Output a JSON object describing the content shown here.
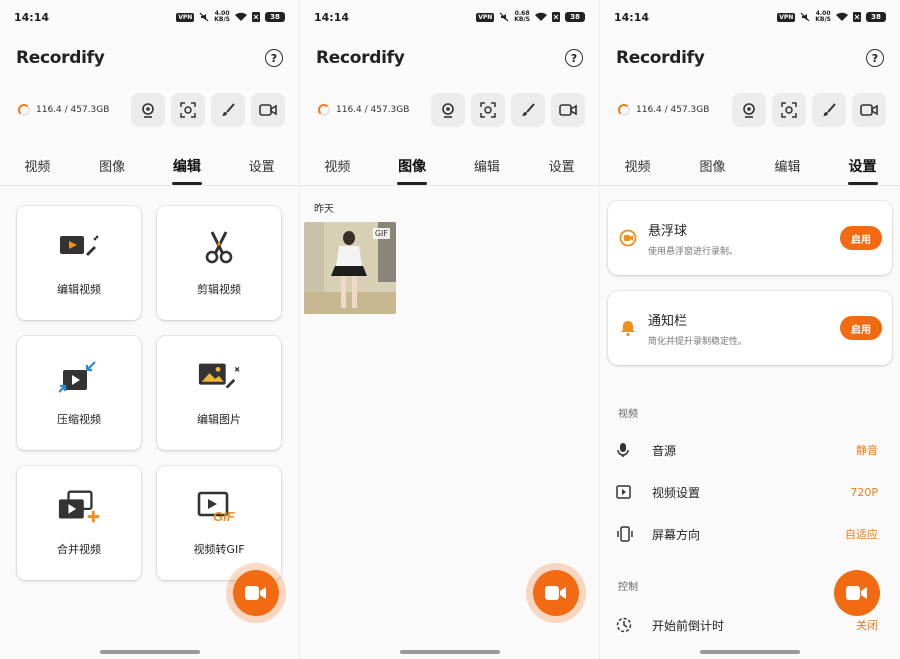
{
  "status": {
    "time": "14:14",
    "vpn": "VPN",
    "battery": "38",
    "speeds": [
      [
        "4.00",
        "KB/S"
      ],
      [
        "0.68",
        "KB/S"
      ],
      [
        "4.00",
        "KB/S"
      ]
    ]
  },
  "app": {
    "title": "Recordify",
    "help": "?"
  },
  "storage": "116.4 / 457.3GB",
  "tabs": [
    "视频",
    "图像",
    "编辑",
    "设置"
  ],
  "edit_cards": [
    {
      "label": "编辑视频",
      "icon": "edit-video-icon"
    },
    {
      "label": "剪辑视频",
      "icon": "scissors-icon"
    },
    {
      "label": "压缩视频",
      "icon": "compress-video-icon"
    },
    {
      "label": "编辑图片",
      "icon": "edit-image-icon"
    },
    {
      "label": "合并视频",
      "icon": "merge-video-icon"
    },
    {
      "label": "视频转GIF",
      "icon": "video-to-gif-icon"
    }
  ],
  "images": {
    "section": "昨天",
    "gif_tag": "GIF"
  },
  "settings": {
    "float_ball": {
      "title": "悬浮球",
      "subtitle": "使用悬浮窗进行录制。",
      "button": "启用"
    },
    "notification": {
      "title": "通知栏",
      "subtitle": "简化并提升录制稳定性。",
      "button": "启用"
    },
    "video_group": "视频",
    "rows": [
      {
        "label": "音源",
        "value": "静音"
      },
      {
        "label": "视频设置",
        "value": "720P"
      },
      {
        "label": "屏幕方向",
        "value": "自适应"
      }
    ],
    "control_group": "控制",
    "countdown": {
      "label": "开始前倒计时",
      "value": "关闭"
    }
  },
  "colors": {
    "accent": "#f26a12"
  }
}
